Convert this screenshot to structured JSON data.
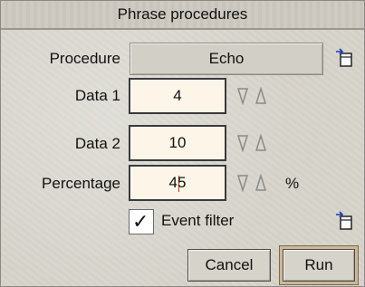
{
  "window": {
    "title": "Phrase procedures"
  },
  "procedure": {
    "label": "Procedure",
    "value": "Echo"
  },
  "data1": {
    "label": "Data 1",
    "value": "4"
  },
  "data2": {
    "label": "Data 2",
    "value": "10"
  },
  "percentage": {
    "label": "Percentage",
    "value": "45",
    "unit": "%"
  },
  "event_filter": {
    "label": "Event filter",
    "checked": true,
    "check_glyph": "✓"
  },
  "buttons": {
    "cancel": "Cancel",
    "run": "Run"
  },
  "icons": {
    "menu": "popup-menu-icon",
    "adjust": "adjust-arrows-icon"
  },
  "colors": {
    "window_bg": "#d6d3cb",
    "field_bg": "#fdf6e8",
    "default_button_ring": "#cbb896",
    "caret": "#d03020"
  }
}
